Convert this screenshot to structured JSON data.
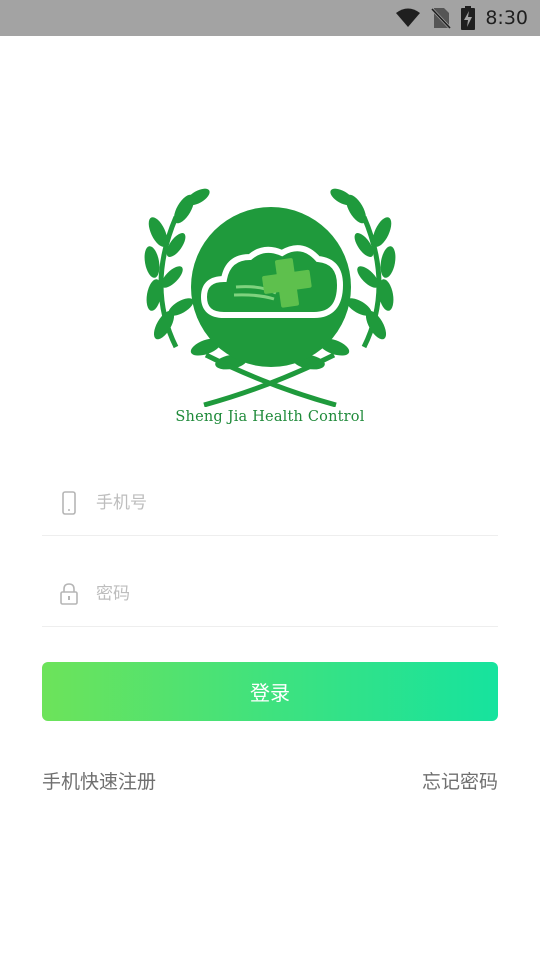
{
  "status_bar": {
    "time": "8:30",
    "icons": [
      "wifi-icon",
      "no-sim-icon",
      "battery-charging-icon"
    ]
  },
  "logo": {
    "caption": "Sheng Jia Health Control",
    "colors": {
      "primary_green": "#1f9a3c",
      "dark_green": "#17772f"
    }
  },
  "form": {
    "phone_placeholder": "手机号",
    "phone_value": "",
    "password_placeholder": "密码",
    "password_value": "",
    "login_label": "登录"
  },
  "links": {
    "register": "手机快速注册",
    "forgot_password": "忘记密码"
  },
  "colors": {
    "button_gradient_start": "#6de35a",
    "button_gradient_end": "#16e39e",
    "placeholder": "#bdbdbd",
    "link_text": "#6f6f6f"
  }
}
